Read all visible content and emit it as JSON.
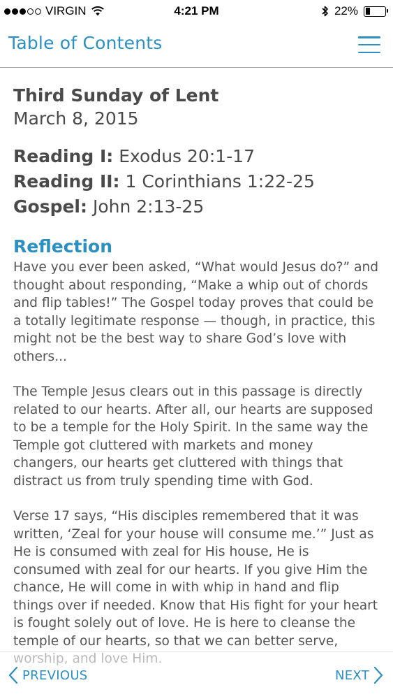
{
  "status_bar": {
    "carrier": "VIRGIN",
    "time": "4:21 PM",
    "battery": "22%"
  },
  "header": {
    "title": "Table of Contents",
    "menu_icon": "hamburger-menu-icon"
  },
  "day": {
    "title": "Third Sunday of Lent",
    "date": "March 8, 2015"
  },
  "readings": [
    {
      "label": "Reading I:",
      "value": "Exodus 20:1-17"
    },
    {
      "label": "Reading II:",
      "value": "1 Corinthians 1:22-25"
    },
    {
      "label": "Gospel:",
      "value": "John 2:13-25"
    }
  ],
  "reflection": {
    "heading": "Reflection",
    "paragraphs": [
      "Have you ever been asked, “What would Jesus do?” and thought about responding, “Make a whip out of chords and flip tables!” The Gospel today proves that could be a totally legitimate response — though, in practice, this might not be the best way to share God’s love with others...",
      "The Temple Jesus clears out in this passage is directly related to our hearts. After all, our hearts are supposed to be a temple for the Holy Spirit. In the same way the Temple got cluttered with markets and money changers, our hearts get cluttered with things that distract us from truly spending time with God.",
      "Verse 17 says, “His disciples remembered that it was written, ‘Zeal for your house will consume me.’” Just as He is consumed with zeal for His house, He is consumed with zeal for our hearts. If you give Him the chance, He will come in with whip in hand and flip things over if needed. Know that His fight for your heart is fought solely out of love. He is here to cleanse the temple of our hearts, so that we can better serve, worship, and love Him."
    ]
  },
  "footer": {
    "previous_label": "PREVIOUS",
    "next_label": "NEXT"
  },
  "colors": {
    "accent": "#2c8fc0",
    "text": "#4a4a4a"
  }
}
